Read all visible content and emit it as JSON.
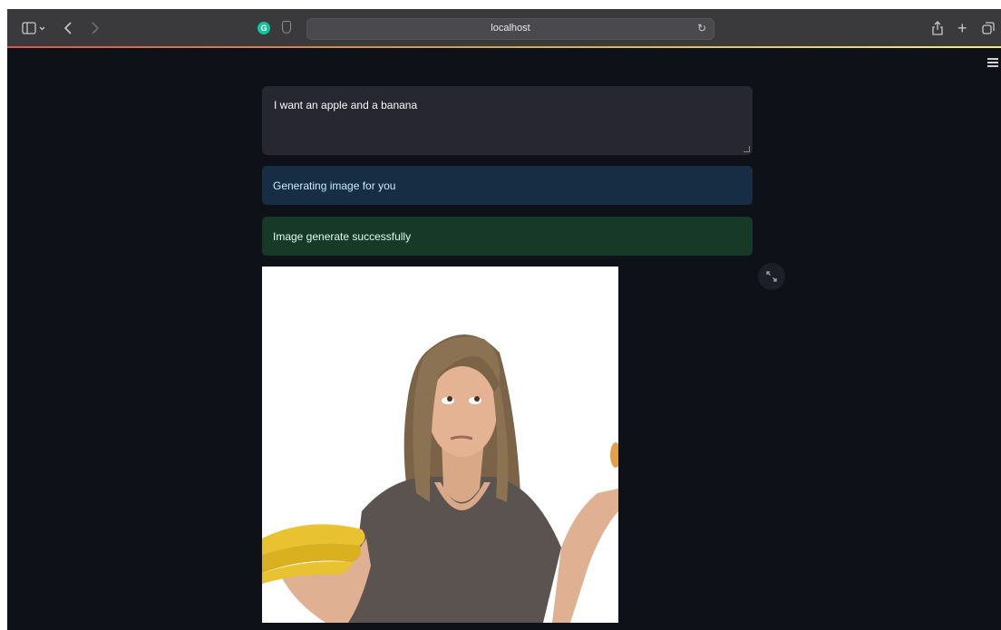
{
  "browser": {
    "url": "localhost",
    "icons": {
      "sidebar": "sidebar-icon",
      "back": "chevron-left-icon",
      "forward": "chevron-right-icon",
      "extension": "grammarly-icon",
      "privacy": "shield-icon",
      "reload": "reload-icon",
      "share": "share-icon",
      "new_tab": "plus-icon",
      "tabs": "tabs-overview-icon"
    }
  },
  "app": {
    "menu_icon": "hamburger-menu-icon",
    "prompt": {
      "value": "I want an apple and a banana"
    },
    "info_message": "Generating image for you",
    "success_message": "Image generate successfully",
    "image": {
      "expand_icon": "fullscreen-icon"
    },
    "colors": {
      "background": "#0e1117",
      "input_bg": "#262730",
      "info_bg": "#172d43",
      "success_bg": "#173928"
    }
  }
}
